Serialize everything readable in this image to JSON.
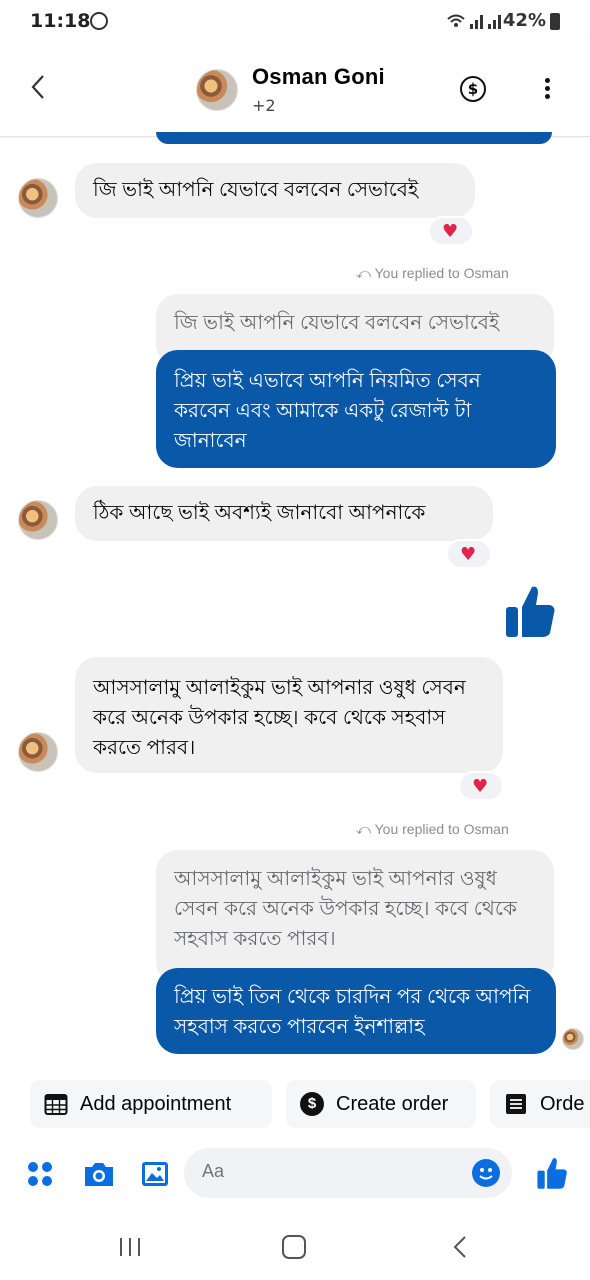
{
  "status_bar": {
    "time": "11:18",
    "battery": "42%"
  },
  "header": {
    "name": "Osman Goni",
    "subtitle": "+2"
  },
  "messages": {
    "m1": {
      "text": "জি ভাই আপনি যেভাবে বলবেন সেভাবেই"
    },
    "reply1": {
      "label": "You replied to Osman",
      "quote": "জি ভাই আপনি যেভাবে বলবেন সেভাবেই",
      "text": "প্রিয় ভাই এভাবে আপনি নিয়মিত সেবন করবেন এবং আমাকে একটু রেজাল্ট টা জানাবেন"
    },
    "m2": {
      "text": "ঠিক আছে ভাই অবশ্যই জানাবো আপনাকে"
    },
    "m3": {
      "text": "আসসালামু আলাইকুম ভাই আপনার ওষুধ সেবন করে অনেক উপকার হচ্ছে। কবে থেকে সহবাস করতে পারব।"
    },
    "reply2": {
      "label": "You replied to Osman",
      "quote": "আসসালামু আলাইকুম ভাই আপনার ওষুধ সেবন করে অনেক উপকার হচ্ছে। কবে থেকে সহবাস করতে পারব।",
      "text": "প্রিয় ভাই তিন থেকে চারদিন পর থেকে আপনি সহবাস করতে পারবেন ইনশাল্লাহ"
    }
  },
  "chips": {
    "appointment": "Add appointment",
    "order": "Create order",
    "orders": "Orde"
  },
  "composer": {
    "placeholder": "Aa"
  },
  "colors": {
    "accent": "#0a58a8",
    "heart": "#e0254d",
    "bubble_in": "#f0f0f0"
  }
}
